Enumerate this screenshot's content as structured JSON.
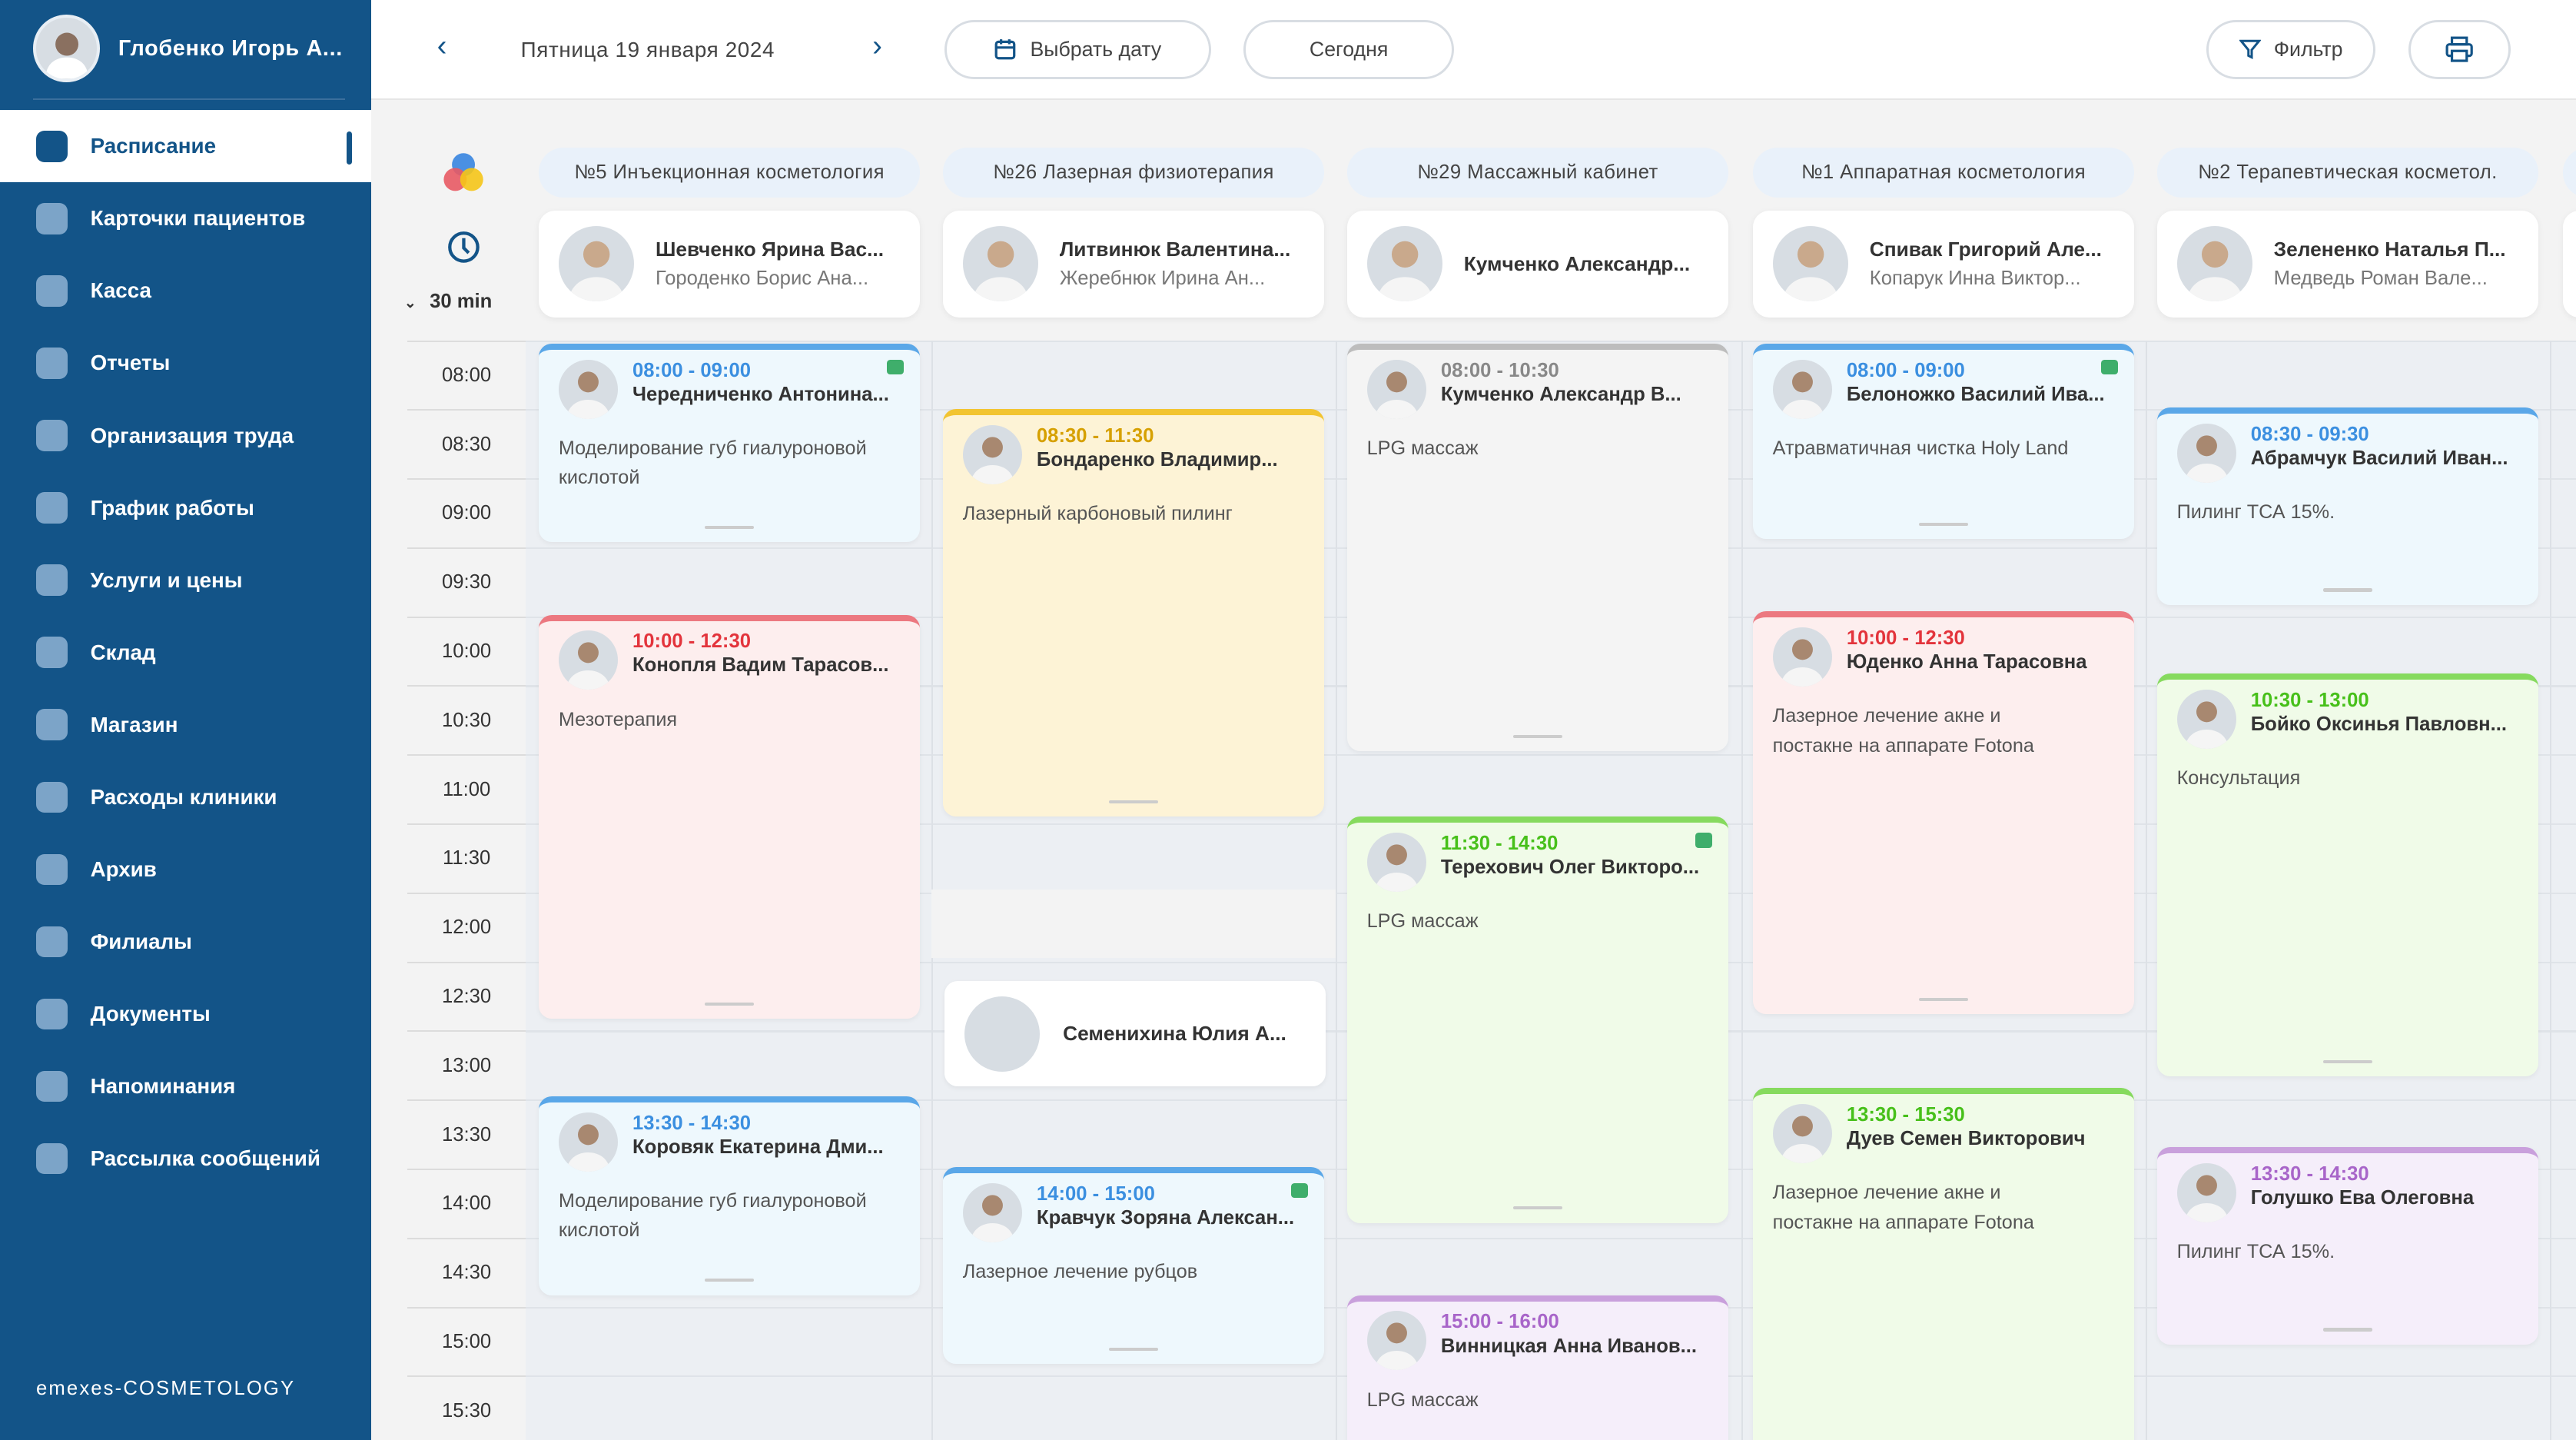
{
  "user": {
    "name": "Глобенко Игорь А..."
  },
  "sidebar": {
    "items": [
      {
        "label": "Расписание",
        "icon": "schedule-icon",
        "active": true
      },
      {
        "label": "Карточки пациентов",
        "icon": "patients-icon"
      },
      {
        "label": "Касса",
        "icon": "wallet-icon"
      },
      {
        "label": "Отчеты",
        "icon": "reports-icon"
      },
      {
        "label": "Организация труда",
        "icon": "briefcase-icon"
      },
      {
        "label": "График работы",
        "icon": "calendar-icon"
      },
      {
        "label": "Услуги и цены",
        "icon": "chart-icon"
      },
      {
        "label": "Склад",
        "icon": "cart-icon"
      },
      {
        "label": "Магазин",
        "icon": "shop-icon"
      },
      {
        "label": "Расходы клиники",
        "icon": "expenses-icon"
      },
      {
        "label": "Архив",
        "icon": "archive-icon"
      },
      {
        "label": "Филиалы",
        "icon": "home-icon"
      },
      {
        "label": "Документы",
        "icon": "document-icon"
      },
      {
        "label": "Напоминания",
        "icon": "bell-icon"
      },
      {
        "label": "Рассылка сообщений",
        "icon": "mail-icon"
      }
    ],
    "logo": "emexes-COSMETOLOGY"
  },
  "header": {
    "date": "Пятница 19 января 2024",
    "pick_date": "Выбрать дату",
    "today": "Сегодня",
    "filter": "Фильтр"
  },
  "interval": "30 min",
  "times": [
    "08:00",
    "08:30",
    "09:00",
    "09:30",
    "10:00",
    "10:30",
    "11:00",
    "11:30",
    "12:00",
    "12:30",
    "13:00",
    "13:30",
    "14:00",
    "14:30",
    "15:00",
    "15:30"
  ],
  "columns": [
    {
      "room": "№5 Инъекционная косметология",
      "doctor": "Шевченко Ярина Вас...",
      "assistant": "Городенко Борис Ана..."
    },
    {
      "room": "№26 Лазерная физиотерапия",
      "doctor": "Литвинюк Валентина...",
      "assistant": "Жеребнюк Ирина Ан..."
    },
    {
      "room": "№29 Массажный кабинет",
      "doctor": "Кумченко Александр...",
      "assistant": ""
    },
    {
      "room": "№1 Аппаратная косметология",
      "doctor": "Спивак Григорий Але...",
      "assistant": "Копарук Инна Виктор..."
    },
    {
      "room": "№2 Терапевтическая косметол.",
      "doctor": "Зелененко Наталья П...",
      "assistant": "Медведь Роман Вале..."
    }
  ],
  "appointments": [
    {
      "col": 0,
      "time": "08:00 - 09:00",
      "patient": "Чередниченко Антонина...",
      "service": "Моделирование губ гиалуроновой кислотой",
      "color": "blue",
      "paid": true
    },
    {
      "col": 0,
      "time": "10:00 - 12:30",
      "patient": "Конопля Вадим Тарасов...",
      "service": "Мезотерапия",
      "color": "red"
    },
    {
      "col": 0,
      "time": "13:30 - 14:30",
      "patient": "Коровяк Екатерина Дми...",
      "service": "Моделирование губ гиалуроновой кислотой",
      "color": "blue"
    },
    {
      "col": 1,
      "time": "08:30 - 11:30",
      "patient": "Бондаренко Владимир...",
      "service": "Лазерный карбоновый пилинг",
      "color": "yellow"
    },
    {
      "col": 1,
      "time": "14:00 - 15:00",
      "patient": "Кравчук Зоряна Алексан...",
      "service": "Лазерное лечение рубцов",
      "color": "blue",
      "paid": true
    },
    {
      "col": 2,
      "time": "08:00 - 10:30",
      "patient": "Кумченко Александр В...",
      "service": "LPG массаж",
      "color": "gray"
    },
    {
      "col": 2,
      "time": "11:30 - 14:30",
      "patient": "Терехович Олег Викторо...",
      "service": "LPG массаж",
      "color": "green",
      "paid": true
    },
    {
      "col": 2,
      "time": "15:00 - 16:00",
      "patient": "Винницкая Анна Иванов...",
      "service": "LPG массаж",
      "color": "purple"
    },
    {
      "col": 3,
      "time": "08:00 - 09:00",
      "patient": "Белоножко Василий Ива...",
      "service": "Атравматичная чистка Holy Land",
      "color": "blue",
      "paid": true
    },
    {
      "col": 3,
      "time": "10:00 - 12:30",
      "patient": "Юденко Анна Тарасовна",
      "service": "Лазерное лечение акне и постакне на аппарате Fotona",
      "color": "red"
    },
    {
      "col": 3,
      "time": "13:30 - 15:30",
      "patient": "Дуев Семен Викторович",
      "service": "Лазерное лечение акне и постакне на аппарате Fotona",
      "color": "green"
    },
    {
      "col": 4,
      "time": "08:30 - 09:30",
      "patient": "Абрамчук Василий Иван...",
      "service": "Пилинг ТСА 15%.",
      "color": "blue"
    },
    {
      "col": 4,
      "time": "10:30 - 13:00",
      "patient": "Бойко Оксинья Павловн...",
      "service": "Консультация",
      "color": "green"
    },
    {
      "col": 4,
      "time": "13:30 - 14:30",
      "patient": "Голушко Ева Олеговна",
      "service": "Пилинг ТСА 15%.",
      "color": "purple"
    }
  ],
  "break_card": {
    "name": "Семенихина Юлия А..."
  },
  "colors": {
    "blue": [
      "#5aa7e8",
      "#eef8fd",
      "#3b8fe0"
    ],
    "red": [
      "#ec7880",
      "#fdeeee",
      "#e3343c"
    ],
    "yellow": [
      "#f2c431",
      "#fdf3d6",
      "#d6a000"
    ],
    "gray": [
      "#bdbdbd",
      "#f4f4f4",
      "#888888"
    ],
    "green": [
      "#86da5e",
      "#f0fbe8",
      "#47c01a"
    ],
    "purple": [
      "#c9a0dc",
      "#f5eefa",
      "#a865c9"
    ],
    "sidebar": "#135488"
  }
}
